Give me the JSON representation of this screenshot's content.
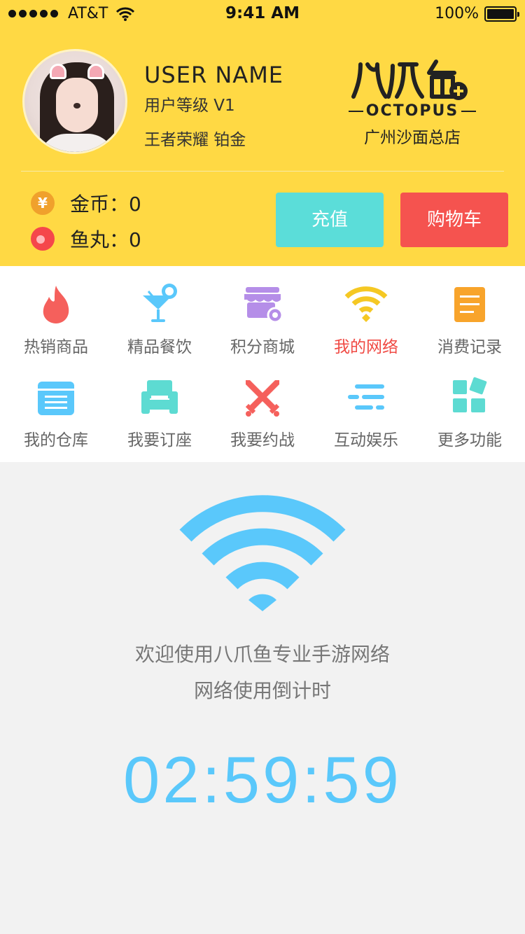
{
  "status_bar": {
    "carrier": "AT&T",
    "time": "9:41 AM",
    "battery": "100%"
  },
  "profile": {
    "user_name": "USER NAME",
    "level": "用户等级   V1",
    "game_rank": "王者荣耀   铂金"
  },
  "brand": {
    "name": "OCTOPUS",
    "store": "广州沙面总店"
  },
  "wallet": {
    "coins": "金币：0",
    "fish_balls": "鱼丸：0",
    "coin_symbol": "¥"
  },
  "actions": {
    "recharge": "充值",
    "cart": "购物车"
  },
  "menu": {
    "items": [
      {
        "label": "热销商品",
        "icon": "flame-icon",
        "color": "#f5605c"
      },
      {
        "label": "精品餐饮",
        "icon": "cocktail-icon",
        "color": "#5ac8fb"
      },
      {
        "label": "积分商城",
        "icon": "store-icon",
        "color": "#b58ee8"
      },
      {
        "label": "我的网络",
        "icon": "wifi-icon",
        "color": "#f5c823",
        "active": true
      },
      {
        "label": "消费记录",
        "icon": "document-icon",
        "color": "#f8a42b"
      },
      {
        "label": "我的仓库",
        "icon": "warehouse-icon",
        "color": "#5ac8fb"
      },
      {
        "label": "我要订座",
        "icon": "sofa-icon",
        "color": "#5ddbd2"
      },
      {
        "label": "我要约战",
        "icon": "swords-icon",
        "color": "#f5605c"
      },
      {
        "label": "互动娱乐",
        "icon": "lines-icon",
        "color": "#5ac8fb"
      },
      {
        "label": "更多功能",
        "icon": "grid-icon",
        "color": "#5ddbd2"
      }
    ]
  },
  "network": {
    "welcome": "欢迎使用八爪鱼专业手游网络",
    "countdown_label": "网络使用倒计时",
    "countdown": "02:59:59"
  },
  "colors": {
    "header": "#ffd944",
    "accent_blue": "#5ac8fb",
    "active_red": "#f04a44"
  }
}
